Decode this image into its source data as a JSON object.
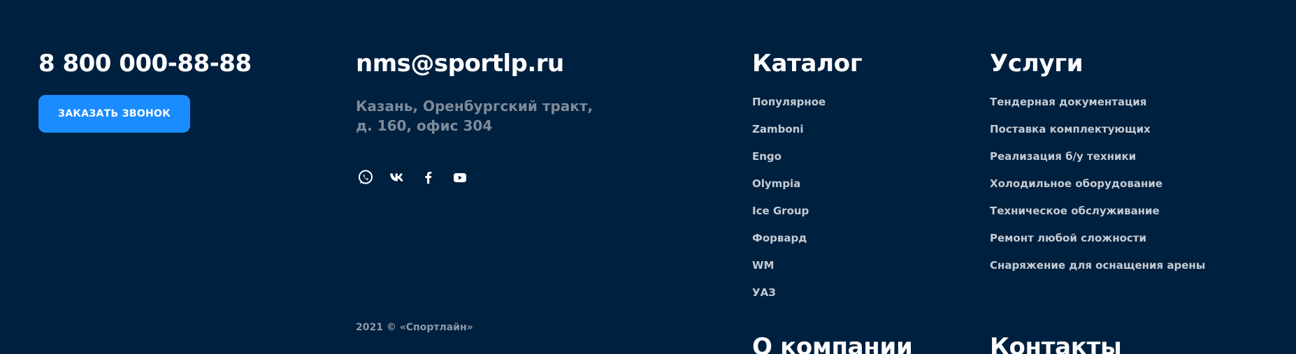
{
  "contact": {
    "phone": "8 800 000-88-88",
    "callback_button": "ЗАКАЗАТЬ ЗВОНОК",
    "email": "nms@sportlp.ru",
    "address": "Казань, Оренбургский тракт, д. 160, офис 304"
  },
  "socials": [
    {
      "icon": "whatsapp-icon"
    },
    {
      "icon": "vk-icon"
    },
    {
      "icon": "facebook-icon"
    },
    {
      "icon": "youtube-icon"
    }
  ],
  "copyright": "2021 © «Спортлайн»",
  "catalog": {
    "title": "Каталог",
    "items": [
      "Популярное",
      "Zamboni",
      "Engo",
      "Olympia",
      "Ice Group",
      "Форвард",
      "WM",
      "УАЗ"
    ]
  },
  "services": {
    "title": "Услуги",
    "items": [
      "Тендерная документация",
      "Поставка комплектующих",
      "Реализация б/у техники",
      "Холодильное оборудование",
      "Техническое обслуживание",
      "Ремонт любой сложности",
      "Снаряжение для оснащения арены"
    ]
  },
  "about": {
    "title": "О компании"
  },
  "contacts": {
    "title": "Контакты"
  },
  "colors": {
    "background": "#00203f",
    "accent": "#1a8cff",
    "muted_text": "#7d8a99",
    "link_text": "#c4cbd3"
  }
}
